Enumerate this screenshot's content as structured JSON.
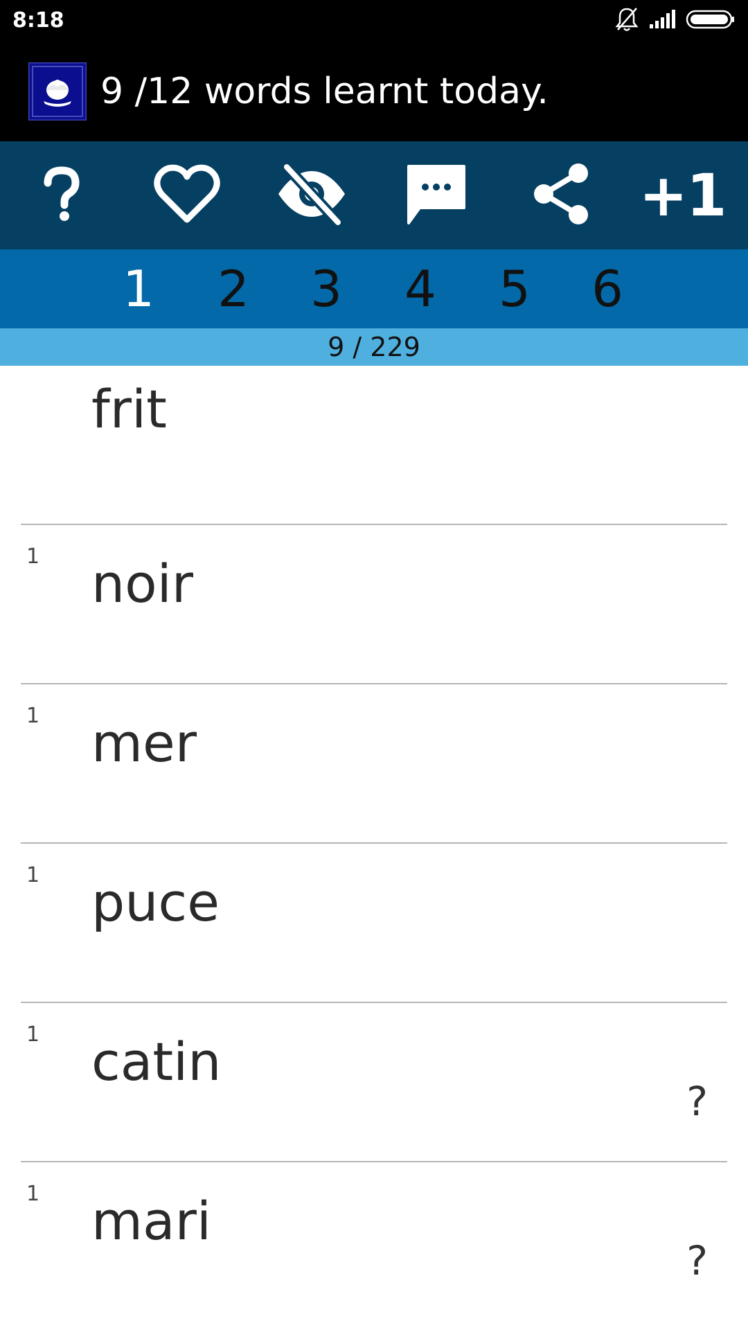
{
  "status_bar": {
    "time": "8:18",
    "icons": [
      "bell-off-icon",
      "signal-icon",
      "battery-icon"
    ]
  },
  "header": {
    "logo": "louisiana-flag-logo",
    "title": "9 /12 words learnt today."
  },
  "toolbar": {
    "buttons": [
      {
        "icon": "help-icon",
        "label": "?"
      },
      {
        "icon": "heart-icon"
      },
      {
        "icon": "eye-off-icon"
      },
      {
        "icon": "comment-icon"
      },
      {
        "icon": "share-icon"
      },
      {
        "icon": "plus-one-icon",
        "label": "+1"
      }
    ]
  },
  "levels": {
    "tabs": [
      "1",
      "2",
      "3",
      "4",
      "5",
      "6"
    ],
    "active_index": 0
  },
  "progress": {
    "text": "9 / 229"
  },
  "words": [
    {
      "count": "",
      "word": "frit",
      "help": ""
    },
    {
      "count": "1",
      "word": "noir",
      "help": ""
    },
    {
      "count": "1",
      "word": "mer",
      "help": ""
    },
    {
      "count": "1",
      "word": "puce",
      "help": ""
    },
    {
      "count": "1",
      "word": "catin",
      "help": "?"
    },
    {
      "count": "1",
      "word": "mari",
      "help": "?"
    }
  ],
  "colors": {
    "status_bg": "#000000",
    "toolbar_bg": "#053f62",
    "levels_bg": "#0369a8",
    "progress_bg": "#4fb0e0",
    "logo_bg": "#0b0f8f"
  }
}
